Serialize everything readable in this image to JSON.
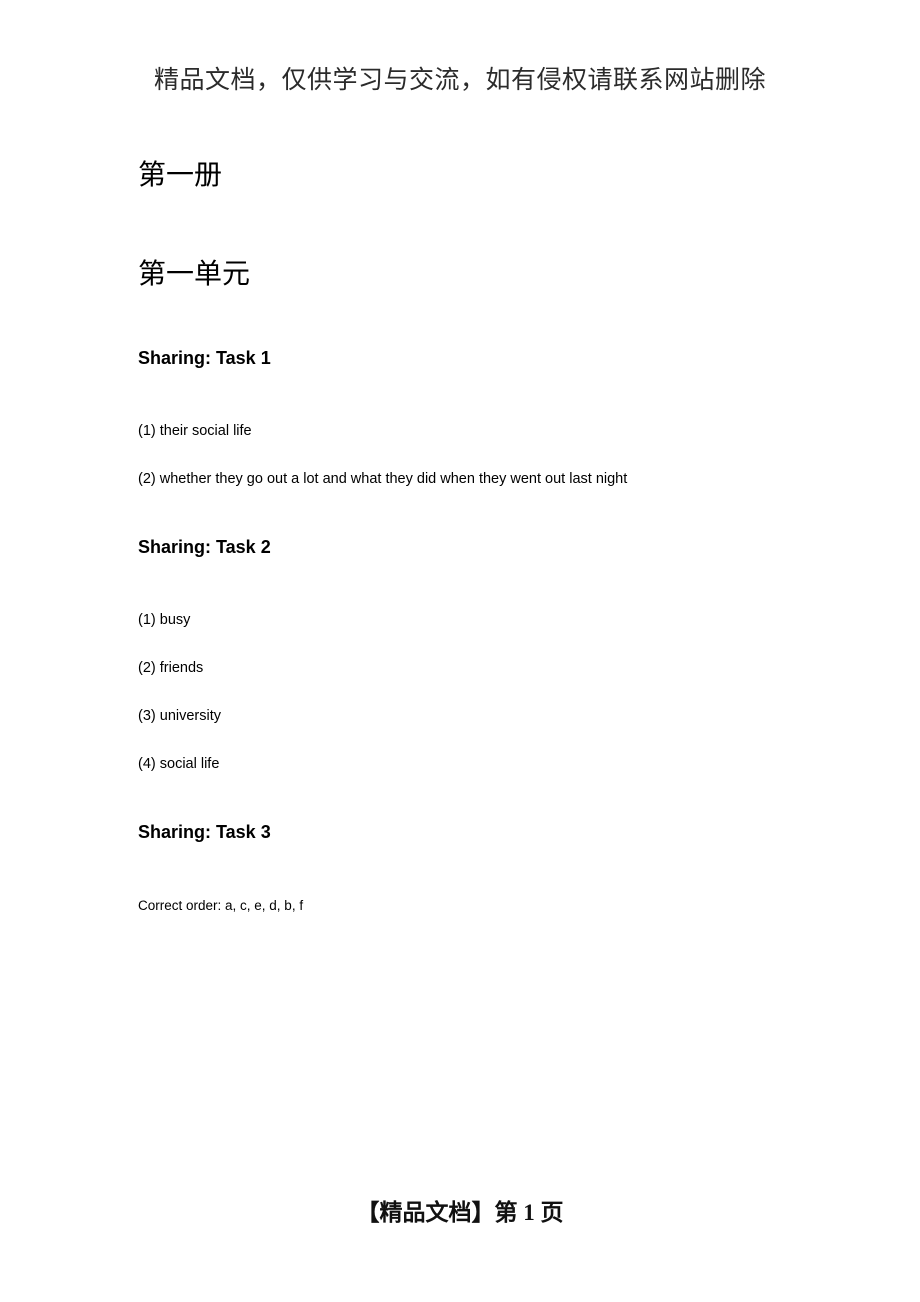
{
  "header": {
    "watermark": "精品文档，仅供学习与交流，如有侵权请联系网站删除"
  },
  "document": {
    "volume_title": "第一册",
    "unit_title": "第一单元",
    "sections": [
      {
        "heading": "Sharing: Task 1",
        "lines": [
          "(1) their social life",
          "(2) whether they go out a lot and what they did when they went out last night"
        ]
      },
      {
        "heading": "Sharing: Task 2",
        "lines": [
          "(1) busy",
          "(2) friends",
          "(3) university",
          "(4) social life"
        ]
      },
      {
        "heading": "Sharing: Task 3",
        "lines": [
          "Correct order: a, c, e, d, b, f"
        ]
      }
    ]
  },
  "footer": {
    "label_open": "【精品文档】",
    "page_word": "第",
    "page_number": "1",
    "page_unit": "页",
    "full_text": "【精品文档】第 1 页"
  }
}
